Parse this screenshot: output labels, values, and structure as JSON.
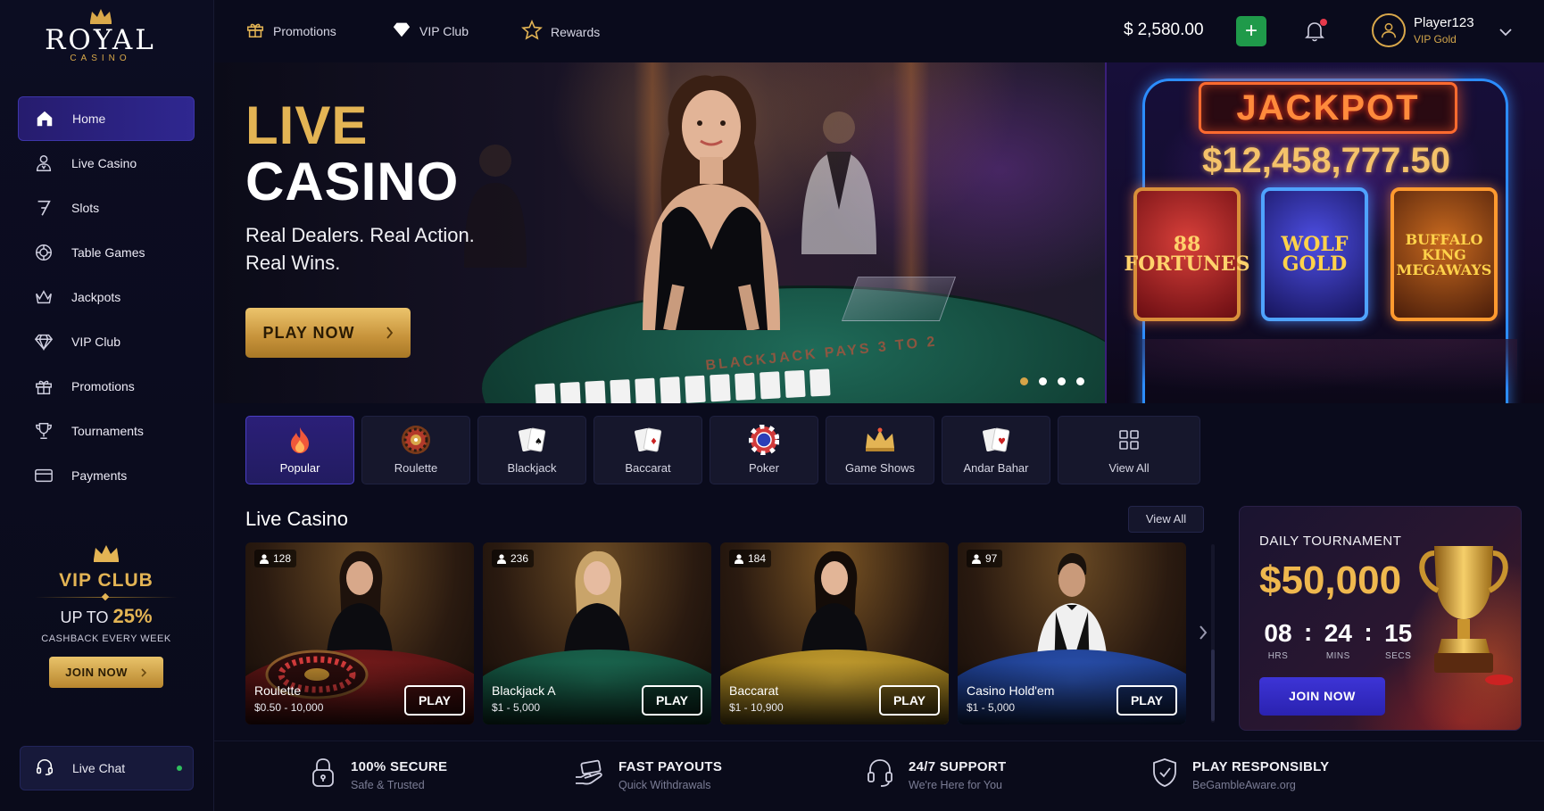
{
  "brand": {
    "name": "ROYAL",
    "sub": "CASINO"
  },
  "sidebar": {
    "items": [
      {
        "label": "Home",
        "icon": "home-icon",
        "active": true
      },
      {
        "label": "Live Casino",
        "icon": "dealer-icon"
      },
      {
        "label": "Slots",
        "icon": "seven-icon"
      },
      {
        "label": "Table Games",
        "icon": "chip-icon"
      },
      {
        "label": "Jackpots",
        "icon": "crown-icon"
      },
      {
        "label": "VIP Club",
        "icon": "diamond-icon"
      },
      {
        "label": "Promotions",
        "icon": "gift-icon"
      },
      {
        "label": "Tournaments",
        "icon": "trophy-icon"
      },
      {
        "label": "Payments",
        "icon": "card-icon"
      }
    ],
    "vip": {
      "title": "VIP CLUB",
      "upto_prefix": "UP TO",
      "upto_value": "25%",
      "cashback": "CASHBACK EVERY WEEK",
      "cta": "JOIN NOW"
    },
    "livechat": "Live Chat"
  },
  "topbar": {
    "links": [
      "Promotions",
      "VIP Club",
      "Rewards"
    ],
    "balance_currency": "$",
    "balance": "2,580.00",
    "username": "Player123",
    "tier": "VIP Gold"
  },
  "hero": {
    "line1": "LIVE",
    "line2": "CASINO",
    "tagline1": "Real Dealers. Real Action.",
    "tagline2": "Real Wins.",
    "cta": "PLAY NOW",
    "felt_text": "BLACKJACK PAYS 3 TO 2",
    "slides": 4,
    "active_slide": 0
  },
  "jackpot": {
    "label": "JACKPOT",
    "amount": "$12,458,777.50",
    "slots": [
      {
        "line1": "88",
        "line2": "FORTUNES"
      },
      {
        "line1": "WOLF",
        "line2": "GOLD"
      },
      {
        "line1": "BUFFALO KING",
        "line2": "MEGAWAYS"
      }
    ]
  },
  "categories": [
    {
      "label": "Popular",
      "icon": "flame-icon",
      "active": true
    },
    {
      "label": "Roulette",
      "icon": "roulette-icon"
    },
    {
      "label": "Blackjack",
      "icon": "blackjack-cards-icon"
    },
    {
      "label": "Baccarat",
      "icon": "baccarat-cards-icon"
    },
    {
      "label": "Poker",
      "icon": "poker-chip-icon"
    },
    {
      "label": "Game Shows",
      "icon": "game-shows-crown-icon"
    },
    {
      "label": "Andar Bahar",
      "icon": "andar-bahar-cards-icon"
    },
    {
      "label": "View All",
      "icon": "grid-icon"
    }
  ],
  "live_casino": {
    "title": "Live Casino",
    "view_all": "View All",
    "tables": [
      {
        "viewers": "128",
        "name": "Roulette",
        "limits": "$0.50 - 10,000",
        "play": "PLAY",
        "felt": "#5a1414"
      },
      {
        "viewers": "236",
        "name": "Blackjack A",
        "limits": "$1 - 5,000",
        "play": "PLAY",
        "felt": "#14503e"
      },
      {
        "viewers": "184",
        "name": "Baccarat",
        "limits": "$1 - 10,900",
        "play": "PLAY",
        "felt": "#a88a20"
      },
      {
        "viewers": "97",
        "name": "Casino Hold'em",
        "limits": "$1 - 5,000",
        "play": "PLAY",
        "felt": "#1d3a8a"
      }
    ]
  },
  "tournament": {
    "label": "DAILY TOURNAMENT",
    "prize": "$50,000",
    "hrs": "08",
    "mins": "24",
    "secs": "15",
    "hrs_label": "HRS",
    "mins_label": "MINS",
    "secs_label": "SECS",
    "cta": "JOIN NOW"
  },
  "features": [
    {
      "title": "100% SECURE",
      "sub": "Safe & Trusted",
      "icon": "lock-icon"
    },
    {
      "title": "FAST PAYOUTS",
      "sub": "Quick Withdrawals",
      "icon": "payout-hand-icon"
    },
    {
      "title": "24/7 SUPPORT",
      "sub": "We're Here for You",
      "icon": "headset-icon"
    },
    {
      "title": "PLAY RESPONSIBLY",
      "sub": "BeGambleAware.org",
      "icon": "shield-icon"
    }
  ],
  "colors": {
    "gold": "#e3b454",
    "accent_purple": "#2f2790",
    "green": "#1f9a4a",
    "bg": "#0a0b1c"
  }
}
